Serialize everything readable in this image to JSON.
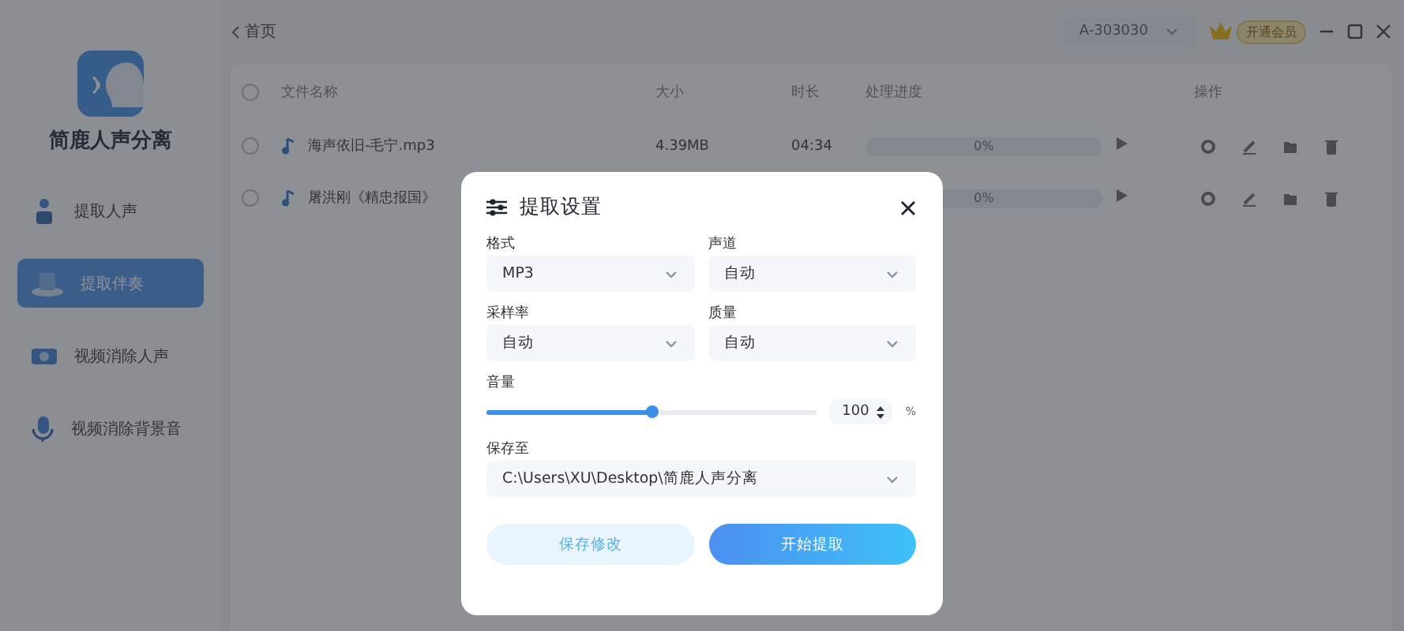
{
  "app": {
    "name": "简鹿人声分离"
  },
  "nav": [
    {
      "label": "提取人声",
      "selected": false
    },
    {
      "label": "提取伴奏",
      "selected": true
    },
    {
      "label": "视频消除人声",
      "selected": false
    },
    {
      "label": "视频消除背景音",
      "selected": false
    }
  ],
  "top_bar": {
    "back": "首页",
    "account": "A-303030",
    "vip": "开通会员"
  },
  "table": {
    "columns": [
      "文件名称",
      "大小",
      "时长",
      "处理进度",
      "操作"
    ],
    "header_checked": false,
    "rows": [
      {
        "checked": false,
        "name": "海声依旧-毛宁.mp3",
        "size": "4.39MB",
        "duration": "04:34",
        "progress": "0%",
        "level": 0
      },
      {
        "checked": false,
        "name": "屠洪刚《精忠报国》",
        "progress": "0%",
        "level": 0
      }
    ]
  },
  "dialog": {
    "title": "提取设置",
    "fields": [
      {
        "label": "格式",
        "value": "MP3"
      },
      {
        "label": "声道",
        "value": "自动"
      },
      {
        "label": "采样率",
        "value": "自动"
      },
      {
        "label": "质量",
        "value": "自动"
      }
    ],
    "volume": {
      "label": "音量",
      "level": 0.5,
      "value": "100",
      "unit": "%"
    },
    "save_to": {
      "label": "保存至",
      "value": "C:\\Users\\XU\\Desktop\\简鹿人声分离"
    },
    "buttons": [
      {
        "label": "保存修改",
        "kind": "secondary"
      },
      {
        "label": "开始提取",
        "kind": "primary"
      }
    ]
  }
}
